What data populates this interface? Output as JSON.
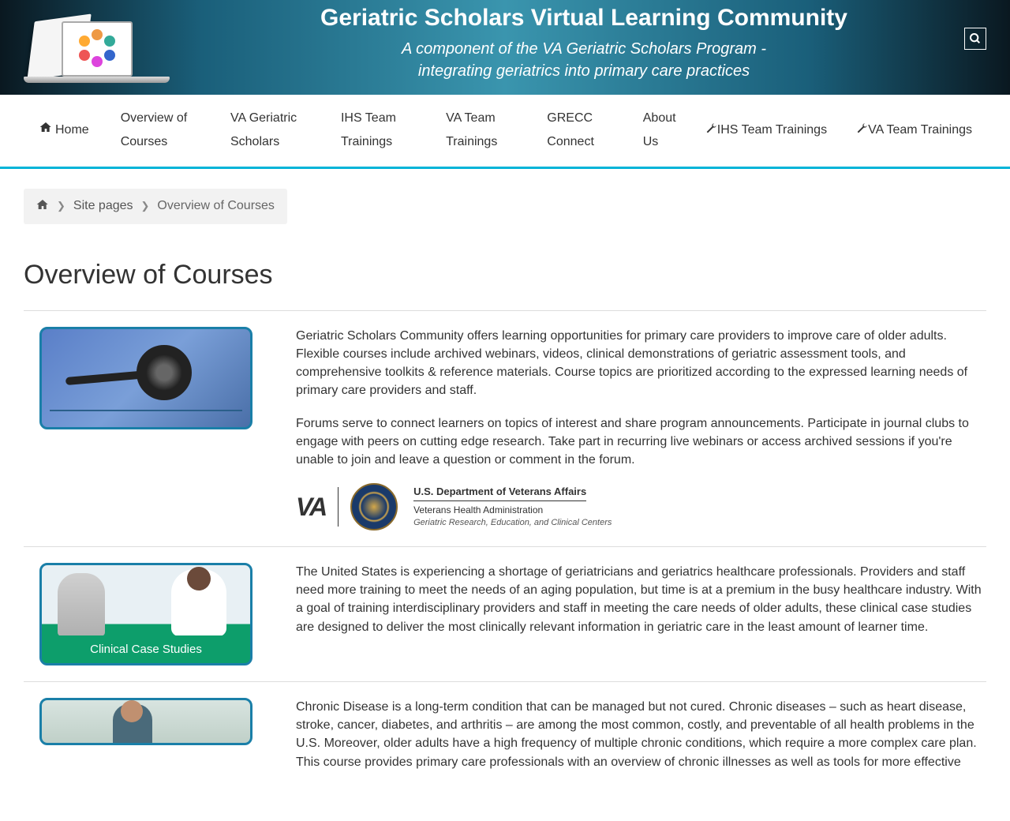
{
  "banner": {
    "title": "Geriatric Scholars Virtual Learning Community",
    "subtitle_line1": "A component of the VA Geriatric Scholars Program -",
    "subtitle_line2": "integrating geriatrics into primary care practices"
  },
  "nav": {
    "home": "Home",
    "items": [
      "Overview of Courses",
      "VA Geriatric Scholars",
      "IHS Team Trainings",
      "VA Team Trainings",
      "GRECC Connect",
      "About Us"
    ],
    "right": [
      "IHS Team Trainings",
      "VA Team Trainings"
    ]
  },
  "breadcrumb": {
    "site_pages": "Site pages",
    "current": "Overview of Courses"
  },
  "page_title": "Overview of Courses",
  "sections": {
    "intro": {
      "p1": "Geriatric Scholars Community offers learning opportunities for primary care providers to improve care of older adults. Flexible courses include archived webinars, videos, clinical demonstrations of geriatric assessment tools, and comprehensive toolkits & reference materials. Course topics are prioritized according to the expressed learning needs of primary care providers and staff.",
      "p2": "Forums serve to connect learners on topics of interest and share program announcements. Participate in journal clubs to engage with peers on cutting edge research.  Take part in recurring live webinars or access archived sessions if you're unable to join and leave a question or comment in the forum."
    },
    "va_block": {
      "logo": "VA",
      "line1": "U.S. Department of Veterans Affairs",
      "line2": "Veterans Health Administration",
      "line3": "Geriatric Research, Education, and Clinical Centers"
    },
    "clinical": {
      "label": "Clinical Case Studies",
      "p1": "The United States is experiencing a shortage of geriatricians and geriatrics healthcare professionals. Providers and staff need more training to meet the needs of an aging population, but time is at a premium in the busy healthcare industry. With a goal of training interdisciplinary providers and staff in meeting the care needs of older adults, these clinical case studies are designed to deliver the most clinically relevant information in geriatric care in the least amount of learner time."
    },
    "chronic": {
      "p1": "Chronic Disease is a long-term condition that can be managed but not cured. Chronic diseases – such as heart disease, stroke, cancer, diabetes, and arthritis – are among the most common, costly, and preventable of all health problems in the U.S. Moreover, older adults have a high frequency of multiple chronic conditions, which require a more complex care plan. This course provides primary care professionals with an overview of chronic illnesses as well as tools for more effective"
    }
  }
}
